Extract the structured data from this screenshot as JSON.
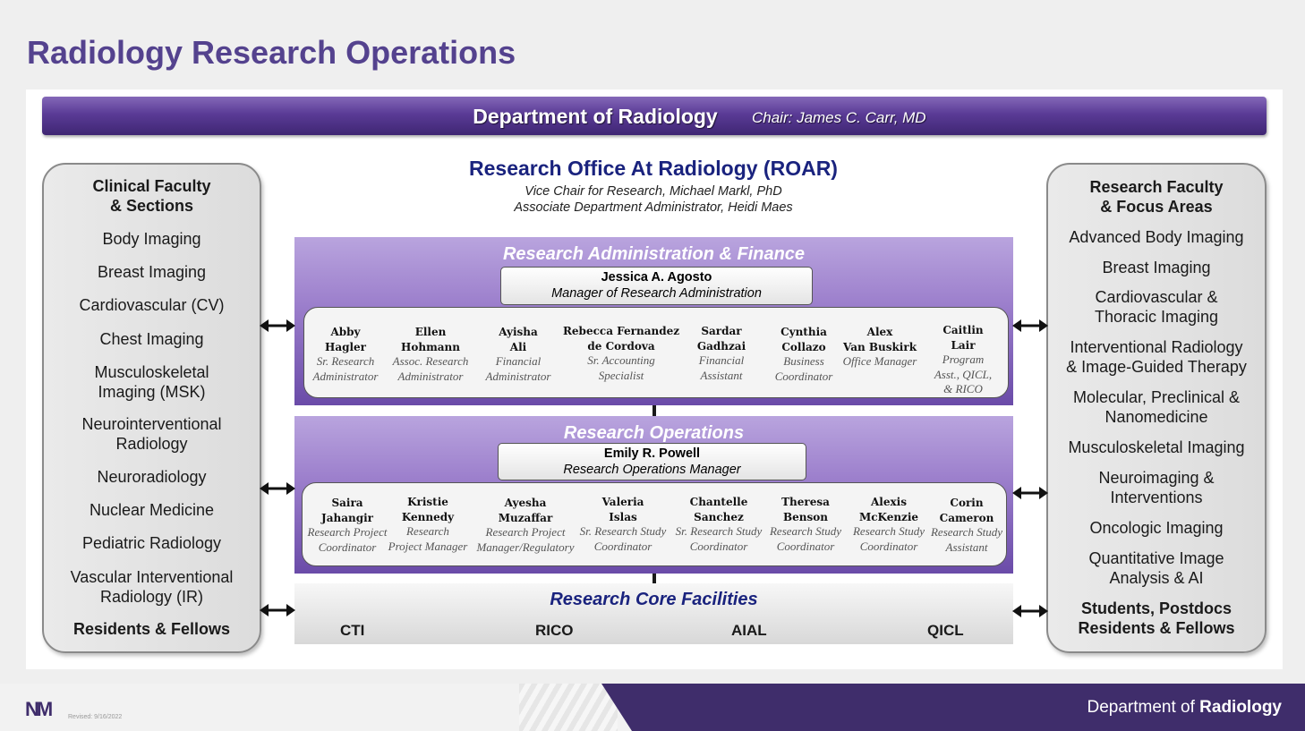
{
  "page": {
    "title": "Radiology Research Operations"
  },
  "banner": {
    "department": "Department of Radiology",
    "chair": "Chair: James C. Carr, MD"
  },
  "roar": {
    "title": "Research Office At Radiology (ROAR)",
    "line1": "Vice Chair for Research, Michael Markl, PhD",
    "line2": "Associate Department Administrator, Heidi Maes"
  },
  "left_panel": {
    "title": "Clinical Faculty\n& Sections",
    "items": [
      "Body Imaging",
      "Breast Imaging",
      "Cardiovascular (CV)",
      "Chest Imaging",
      "Musculoskeletal\nImaging (MSK)",
      "Neurointerventional\nRadiology",
      "Neuroradiology",
      "Nuclear Medicine",
      "Pediatric Radiology",
      "Vascular Interventional\nRadiology (IR)"
    ],
    "footer": "Residents & Fellows"
  },
  "right_panel": {
    "title": "Research Faculty\n& Focus Areas",
    "items": [
      "Advanced Body Imaging",
      "Breast Imaging",
      "Cardiovascular &\nThoracic Imaging",
      "Interventional Radiology\n& Image-Guided Therapy",
      "Molecular, Preclinical &\nNanomedicine",
      "Musculoskeletal Imaging",
      "Neuroimaging &\nInterventions",
      "Oncologic Imaging",
      "Quantitative Image\nAnalysis & AI"
    ],
    "footer": "Students, Postdocs\nResidents & Fellows"
  },
  "admin_finance": {
    "title": "Research Administration & Finance",
    "manager_name": "Jessica A. Agosto",
    "manager_role": "Manager of Research Administration",
    "staff": [
      {
        "name": "Abby\nHagler",
        "role": "Sr. Research\nAdministrator"
      },
      {
        "name": "Ellen\nHohmann",
        "role": "Assoc. Research\nAdministrator"
      },
      {
        "name": "Ayisha\nAli",
        "role": "Financial\nAdministrator"
      },
      {
        "name": "Rebecca Fernandez\nde Cordova",
        "role": "Sr. Accounting\nSpecialist"
      },
      {
        "name": "Sardar\nGadhzai",
        "role": "Financial\nAssistant"
      },
      {
        "name": "Cynthia\nCollazo",
        "role": "Business\nCoordinator"
      },
      {
        "name": "Alex\nVan Buskirk",
        "role": "Office Manager"
      },
      {
        "name": "Caitlin\nLair",
        "role": "Program\nAsst., QICL,\n& RICO"
      }
    ]
  },
  "operations": {
    "title": "Research Operations",
    "manager_name": "Emily R. Powell",
    "manager_role": "Research Operations Manager",
    "staff": [
      {
        "name": "Saira\nJahangir",
        "role": "Research Project\nCoordinator"
      },
      {
        "name": "Kristie\nKennedy",
        "role": "Research\nProject Manager"
      },
      {
        "name": "Ayesha\nMuzaffar",
        "role": "Research Project\nManager/Regulatory"
      },
      {
        "name": "Valeria\nIslas",
        "role": "Sr. Research Study\nCoordinator"
      },
      {
        "name": "Chantelle\nSanchez",
        "role": "Sr. Research Study\nCoordinator"
      },
      {
        "name": "Theresa\nBenson",
        "role": "Research Study\nCoordinator"
      },
      {
        "name": "Alexis\nMcKenzie",
        "role": "Research Study\nCoordinator"
      },
      {
        "name": "Corin\nCameron",
        "role": "Research Study\nAssistant"
      }
    ]
  },
  "core": {
    "title": "Research Core Facilities",
    "items": [
      "CTI",
      "RICO",
      "AIAL",
      "QICL"
    ]
  },
  "footer": {
    "logo": "NM",
    "revised": "Revised: 9/16/2022",
    "dept_prefix": "Department of ",
    "dept_bold": "Radiology"
  },
  "colors": {
    "purple": "#54428e",
    "navy": "#1a237e",
    "footer_purple": "#3f2d6b"
  }
}
